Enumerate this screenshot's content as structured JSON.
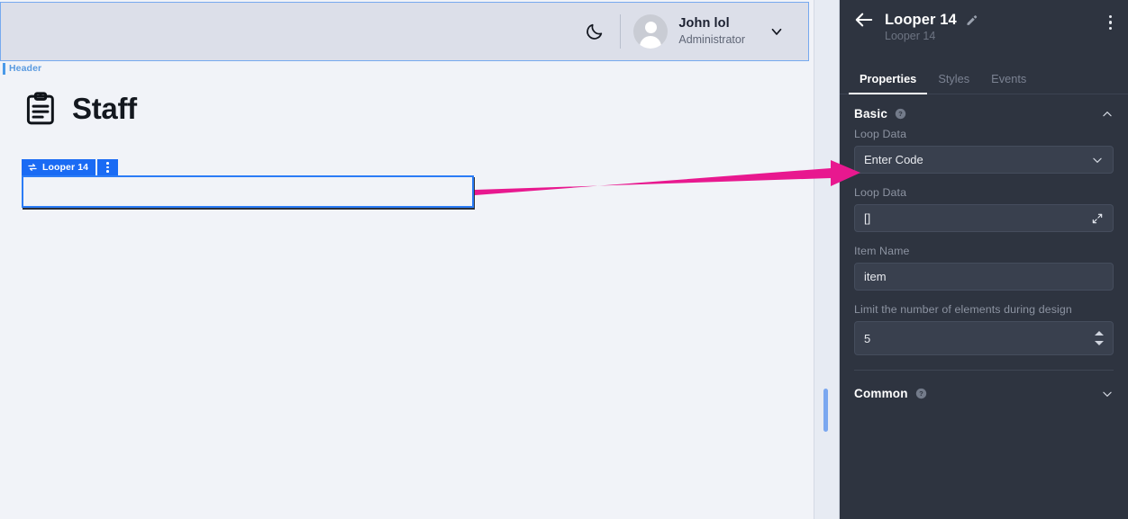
{
  "canvas": {
    "header": {
      "layer_label": "Header",
      "dark_mode_icon": "moon-icon",
      "avatar_icon": "person-avatar-icon",
      "user_name": "John lol",
      "user_role": "Administrator",
      "chevron_icon": "chevron-down-icon"
    },
    "page": {
      "icon": "clipboard-list-icon",
      "title": "Staff"
    },
    "selected_component": {
      "tag_icon": "loop-repeat-icon",
      "tag_label": "Looper 14",
      "menu_icon": "kebab-menu-icon",
      "accent_color": "#1a6bf4"
    },
    "scrollbar": {
      "thumb_color": "#7aa7f0"
    }
  },
  "panel": {
    "back_icon": "arrow-left-icon",
    "title": "Looper 14",
    "edit_icon": "pencil-edit-icon",
    "kebab_icon": "kebab-menu-icon",
    "subtitle": "Looper 14",
    "tabs": [
      {
        "label": "Properties",
        "active": true
      },
      {
        "label": "Styles",
        "active": false
      },
      {
        "label": "Events",
        "active": false
      }
    ],
    "sections": [
      {
        "title": "Basic",
        "help_icon": "help-circle-icon",
        "chevron_icon": "chevron-up-icon",
        "expanded": true
      },
      {
        "title": "Common",
        "help_icon": "help-circle-icon",
        "chevron_icon": "chevron-down-icon",
        "expanded": false
      }
    ],
    "fields": {
      "loop_data_mode": {
        "label": "Loop Data",
        "value": "Enter Code",
        "icon": "chevron-down-icon"
      },
      "loop_data_code": {
        "label": "Loop Data",
        "value": "[]",
        "icon": "expand-diagonal-icon"
      },
      "item_name": {
        "label": "Item Name",
        "value": "item"
      },
      "limit_elements": {
        "label": "Limit the number of elements during design",
        "value": "5",
        "icon": "number-stepper-icon"
      }
    }
  },
  "annotation": {
    "arrow_color": "#e8188f",
    "arrow_name": "pointer-arrow-annotation"
  },
  "theme": {
    "panel_bg": "#2e3440",
    "canvas_bg": "#f1f3f8",
    "accent_blue": "#1a6bf4"
  }
}
